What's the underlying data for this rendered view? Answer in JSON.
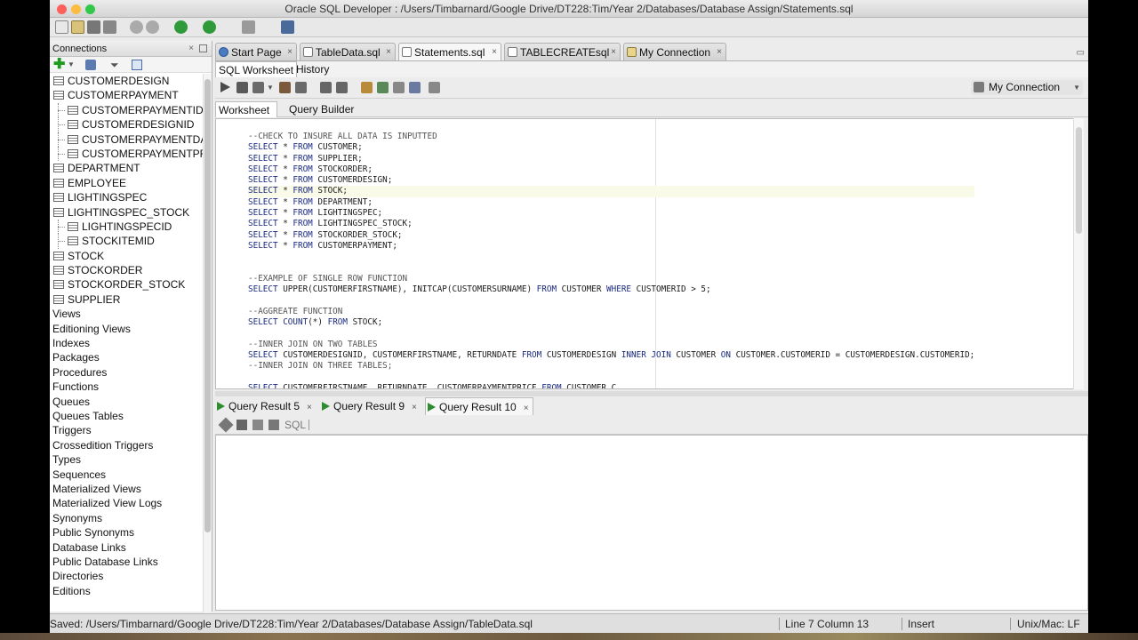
{
  "window": {
    "title": "Oracle SQL Developer : /Users/Timbarnard/Google Drive/DT228:Tim/Year 2/Databases/Database Assign/Statements.sql"
  },
  "connections_panel": {
    "title": "Connections",
    "tree": [
      {
        "label": "CUSTOMERDESIGN",
        "level": 1
      },
      {
        "label": "CUSTOMERPAYMENT",
        "level": 1
      },
      {
        "label": "CUSTOMERPAYMENTID",
        "level": 2
      },
      {
        "label": "CUSTOMERDESIGNID",
        "level": 2
      },
      {
        "label": "CUSTOMERPAYMENTDA",
        "level": 2
      },
      {
        "label": "CUSTOMERPAYMENTPRI",
        "level": 2
      },
      {
        "label": "DEPARTMENT",
        "level": 1
      },
      {
        "label": "EMPLOYEE",
        "level": 1
      },
      {
        "label": "LIGHTINGSPEC",
        "level": 1
      },
      {
        "label": "LIGHTINGSPEC_STOCK",
        "level": 1
      },
      {
        "label": "LIGHTINGSPECID",
        "level": 2
      },
      {
        "label": "STOCKITEMID",
        "level": 2
      },
      {
        "label": "STOCK",
        "level": 1
      },
      {
        "label": "STOCKORDER",
        "level": 1
      },
      {
        "label": "STOCKORDER_STOCK",
        "level": 1
      },
      {
        "label": "SUPPLIER",
        "level": 1
      },
      {
        "label": "Views",
        "level": 0
      },
      {
        "label": "Editioning Views",
        "level": 0
      },
      {
        "label": "Indexes",
        "level": 0
      },
      {
        "label": "Packages",
        "level": 0
      },
      {
        "label": "Procedures",
        "level": 0
      },
      {
        "label": "Functions",
        "level": 0
      },
      {
        "label": "Queues",
        "level": 0
      },
      {
        "label": "Queues Tables",
        "level": 0
      },
      {
        "label": "Triggers",
        "level": 0
      },
      {
        "label": "Crossedition Triggers",
        "level": 0
      },
      {
        "label": "Types",
        "level": 0
      },
      {
        "label": "Sequences",
        "level": 0
      },
      {
        "label": "Materialized Views",
        "level": 0
      },
      {
        "label": "Materialized View Logs",
        "level": 0
      },
      {
        "label": "Synonyms",
        "level": 0
      },
      {
        "label": "Public Synonyms",
        "level": 0
      },
      {
        "label": "Database Links",
        "level": 0
      },
      {
        "label": "Public Database Links",
        "level": 0
      },
      {
        "label": "Directories",
        "level": 0
      },
      {
        "label": "Editions",
        "level": 0
      }
    ]
  },
  "editor_tabs": [
    "Start Page",
    "TableData.sql",
    "Statements.sql",
    "TABLECREATEsql",
    "My Connection"
  ],
  "sub_tabs": {
    "worksheet": "SQL Worksheet",
    "history": "History"
  },
  "connection_selector": "My Connection",
  "worksheet_tabs": {
    "worksheet": "Worksheet",
    "query_builder": "Query Builder"
  },
  "code_lines": [
    "--CHECK TO INSURE ALL DATA IS INPUTTED",
    "SELECT * FROM CUSTOMER;",
    "SELECT * FROM SUPPLIER;",
    "SELECT * FROM STOCKORDER;",
    "SELECT * FROM CUSTOMERDESIGN;",
    "SELECT * FROM STOCK;",
    "SELECT * FROM DEPARTMENT;",
    "SELECT * FROM LIGHTINGSPEC;",
    "SELECT * FROM LIGHTINGSPEC_STOCK;",
    "SELECT * FROM STOCKORDER_STOCK;",
    "SELECT * FROM CUSTOMERPAYMENT;",
    "",
    "",
    "--EXAMPLE OF SINGLE ROW FUNCTION",
    "SELECT UPPER(CUSTOMERFIRSTNAME), INITCAP(CUSTOMERSURNAME) FROM CUSTOMER WHERE CUSTOMERID > 5;",
    "",
    "--AGGREATE FUNCTION",
    "SELECT COUNT(*) FROM STOCK;",
    "",
    "--INNER JOIN ON TWO TABLES",
    "SELECT CUSTOMERDESIGNID, CUSTOMERFIRSTNAME, RETURNDATE FROM CUSTOMERDESIGN INNER JOIN CUSTOMER ON CUSTOMER.CUSTOMERID = CUSTOMERDESIGN.CUSTOMERID;",
    "--INNER JOIN ON THREE TABLES;",
    "",
    "SELECT CUSTOMERFIRSTNAME, RETURNDATE, CUSTOMERPAYMENTPRICE FROM CUSTOMER C"
  ],
  "result_tabs": [
    "Query Result 5",
    "Query Result 9",
    "Query Result 10"
  ],
  "result_toolbar": {
    "sql_label": "SQL"
  },
  "status": {
    "message": "Saved: /Users/Timbarnard/Google Drive/DT228:Tim/Year 2/Databases/Database Assign/TableData.sql",
    "position": "Line 7 Column 13",
    "mode": "Insert",
    "line_ending": "Unix/Mac: LF"
  },
  "colors": {
    "keyword": "#1a2a80",
    "comment": "#555555",
    "run_green": "#2e8b2e"
  }
}
